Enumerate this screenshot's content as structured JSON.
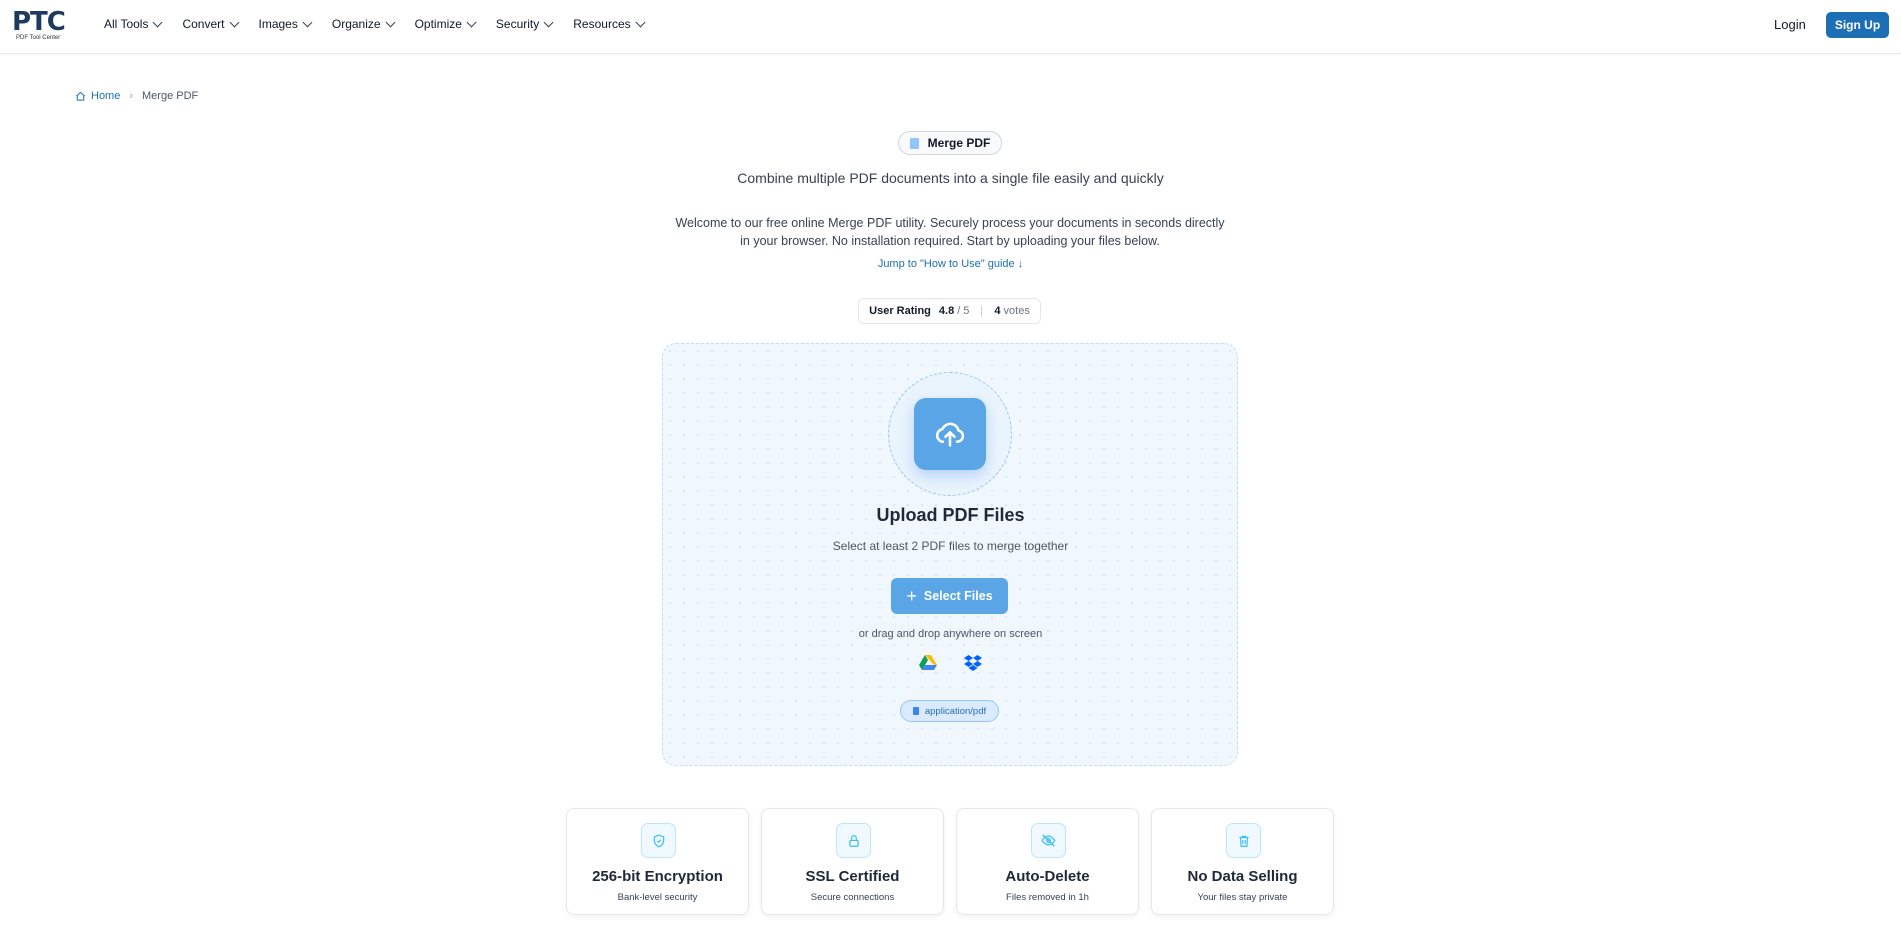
{
  "header": {
    "logo_text": "PTC",
    "logo_sub": "PDF Tool Center",
    "nav": [
      "All Tools",
      "Convert",
      "Images",
      "Organize",
      "Optimize",
      "Security",
      "Resources"
    ],
    "login_label": "Login",
    "signup_label": "Sign Up"
  },
  "breadcrumb": {
    "home_label": "Home",
    "separator": "›",
    "current": "Merge PDF"
  },
  "hero": {
    "title": "Merge PDF",
    "subtitle": "Combine multiple PDF documents into a single file easily and quickly",
    "description": "Welcome to our free online Merge PDF utility. Securely process your documents in seconds directly in your browser. No installation required. Start by uploading your files below.",
    "jump_link": "Jump to \"How to Use\" guide ↓"
  },
  "rating": {
    "label": "User Rating",
    "value": "4.8",
    "out_of": "/ 5",
    "votes_count": "4",
    "votes_label": "votes"
  },
  "upload": {
    "title": "Upload PDF Files",
    "subtitle": "Select at least 2 PDF files to merge together",
    "button_label": "Select Files",
    "drag_hint": "or drag and drop anywhere on screen",
    "accepted_type": "application/pdf"
  },
  "features": [
    {
      "title": "256-bit Encryption",
      "sub": "Bank-level security",
      "icon": "shield-icon"
    },
    {
      "title": "SSL Certified",
      "sub": "Secure connections",
      "icon": "lock-icon"
    },
    {
      "title": "Auto-Delete",
      "sub": "Files removed in 1h",
      "icon": "eye-off-icon"
    },
    {
      "title": "No Data Selling",
      "sub": "Your files stay private",
      "icon": "trash-icon"
    }
  ],
  "colors": {
    "brand": "#1d6fb5",
    "upload_accent": "#5aa5e6",
    "dropzone_bg": "#f1f8fd"
  }
}
